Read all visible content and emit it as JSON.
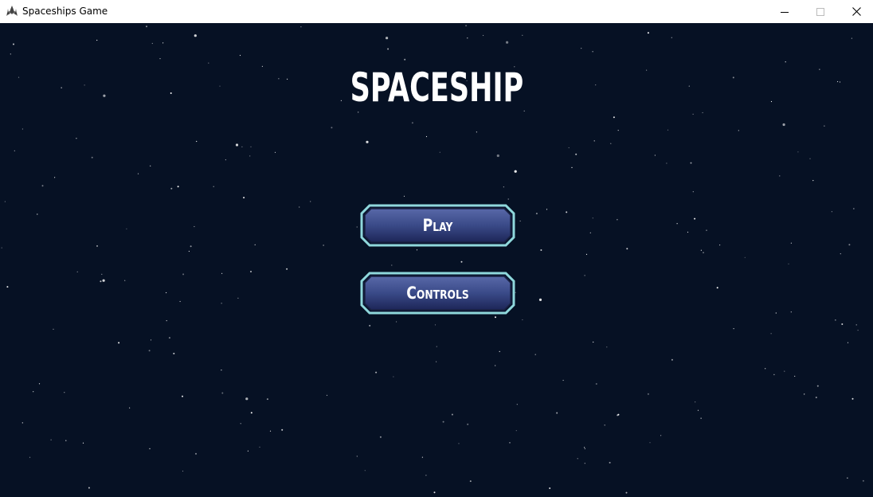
{
  "window": {
    "title": "Spaceships Game",
    "icon": "spaceship-icon",
    "controls": [
      "minimize-icon",
      "maximize-icon",
      "close-icon"
    ]
  },
  "game": {
    "title": "SPACESHIP",
    "background_color": "#061124",
    "menu": {
      "play_label": "Play",
      "controls_label": "Controls"
    },
    "button_colors": {
      "border": "#8fd8dc",
      "fill_top": "#4a5c9c",
      "fill_bottom": "#1f2a5a"
    }
  }
}
